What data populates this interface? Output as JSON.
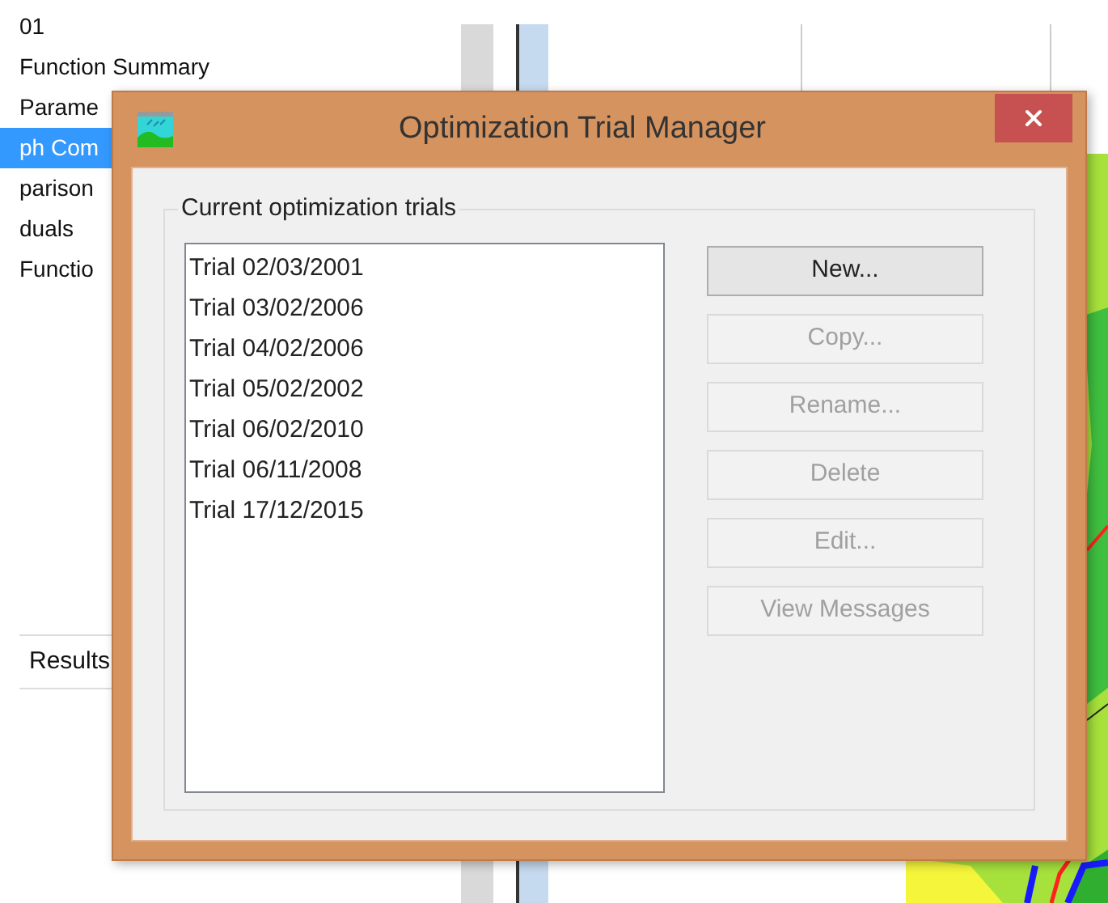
{
  "tree": {
    "items": [
      {
        "label": "01",
        "selected": false
      },
      {
        "label": "Function Summary",
        "selected": false
      },
      {
        "label": "Parame",
        "selected": false
      },
      {
        "label": "ph Com",
        "selected": true
      },
      {
        "label": "parison",
        "selected": false
      },
      {
        "label": "duals",
        "selected": false
      },
      {
        "label": "Functio",
        "selected": false
      }
    ]
  },
  "results_tab": {
    "label": "Results"
  },
  "dialog": {
    "title": "Optimization Trial Manager",
    "group_label": "Current optimization trials",
    "trials": [
      {
        "label": "Trial 02/03/2001",
        "selected": false
      },
      {
        "label": "Trial 03/02/2006",
        "selected": false
      },
      {
        "label": "Trial 04/02/2006",
        "selected": false
      },
      {
        "label": "Trial 05/02/2002",
        "selected": false
      },
      {
        "label": "Trial 06/02/2010",
        "selected": false
      },
      {
        "label": "Trial 06/11/2008",
        "selected": false
      },
      {
        "label": "Trial 17/12/2015",
        "selected": false
      }
    ],
    "buttons": [
      {
        "label": "New...",
        "disabled": false
      },
      {
        "label": "Copy...",
        "disabled": true
      },
      {
        "label": "Rename...",
        "disabled": true
      },
      {
        "label": "Delete",
        "disabled": true
      },
      {
        "label": "Edit...",
        "disabled": true
      },
      {
        "label": "View Messages",
        "disabled": true
      }
    ]
  }
}
